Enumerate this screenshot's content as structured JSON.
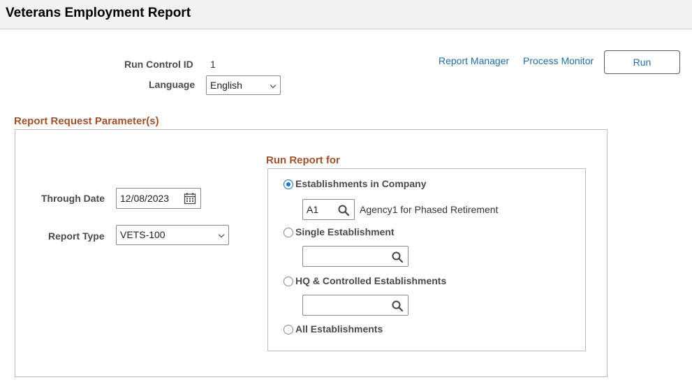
{
  "header": {
    "title": "Veterans Employment Report"
  },
  "run_control": {
    "run_control_label": "Run Control ID",
    "run_control_value": "1",
    "language_label": "Language",
    "language_value": "English"
  },
  "toolbar": {
    "report_manager": "Report Manager",
    "process_monitor": "Process Monitor",
    "run": "Run"
  },
  "params": {
    "section_title": "Report Request Parameter(s)",
    "through_date_label": "Through Date",
    "through_date_value": "12/08/2023",
    "report_type_label": "Report Type",
    "report_type_value": "VETS-100"
  },
  "run_for": {
    "title": "Run Report for",
    "options": [
      {
        "label": "Establishments in Company",
        "selected": true
      },
      {
        "label": "Single Establishment",
        "selected": false
      },
      {
        "label": "HQ & Controlled Establishments",
        "selected": false
      },
      {
        "label": "All Establishments",
        "selected": false
      }
    ],
    "company_code": "A1",
    "company_desc": "Agency1 for Phased Retirement",
    "single_value": "",
    "hq_value": ""
  },
  "colors": {
    "link": "#1f6ea8",
    "section": "#a0522d",
    "radio": "#1a73c9"
  }
}
